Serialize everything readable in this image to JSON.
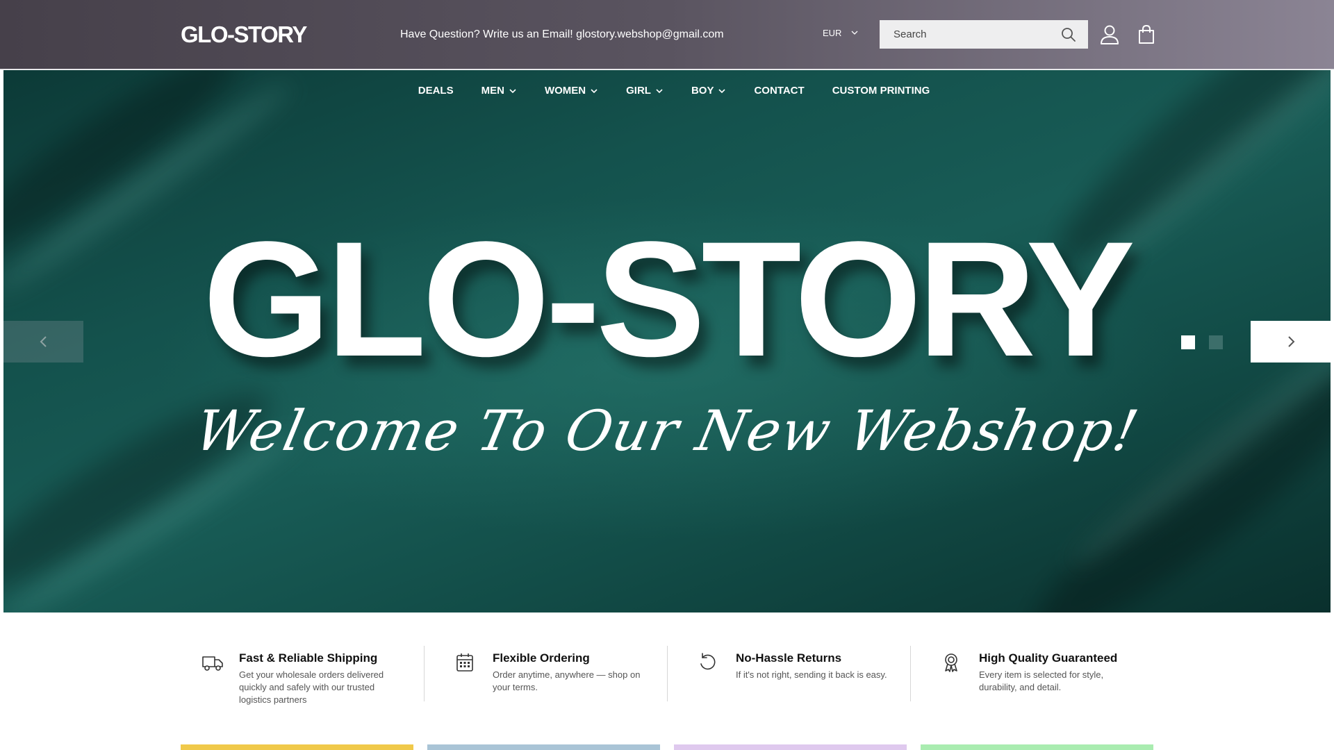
{
  "header": {
    "logo": "GLO-STORY",
    "announcement": "Have Question? Write us an Email! glostory.webshop@gmail.com",
    "currency": "EUR",
    "search_placeholder": "Search"
  },
  "nav": {
    "items": [
      {
        "label": "DEALS",
        "dropdown": false
      },
      {
        "label": "MEN",
        "dropdown": true
      },
      {
        "label": "WOMEN",
        "dropdown": true
      },
      {
        "label": "GIRL",
        "dropdown": true
      },
      {
        "label": "BOY",
        "dropdown": true
      },
      {
        "label": "CONTACT",
        "dropdown": false
      },
      {
        "label": "CUSTOM PRINTING",
        "dropdown": false
      }
    ]
  },
  "hero": {
    "title": "GLO-STORY",
    "subtitle": "Welcome To Our New Webshop!",
    "slide_count": 2,
    "active_slide": 1
  },
  "features": [
    {
      "icon": "truck-icon",
      "title": "Fast & Reliable Shipping",
      "description": "Get your wholesale orders delivered quickly and safely with our trusted logistics partners"
    },
    {
      "icon": "calendar-icon",
      "title": "Flexible Ordering",
      "description": "Order anytime, anywhere — shop on your terms."
    },
    {
      "icon": "return-icon",
      "title": "No-Hassle Returns",
      "description": "If it's not right, sending it back is easy."
    },
    {
      "icon": "award-icon",
      "title": "High Quality Guaranteed",
      "description": "Every item is selected for style, durability, and detail."
    }
  ],
  "colors": {
    "header_gradient_start": "#46404a",
    "header_gradient_end": "#8b8494",
    "hero_green": "#14524d",
    "card_colors": [
      "#f0c94a",
      "#a9c4d6",
      "#dfc9ee",
      "#a9ecb0"
    ]
  }
}
